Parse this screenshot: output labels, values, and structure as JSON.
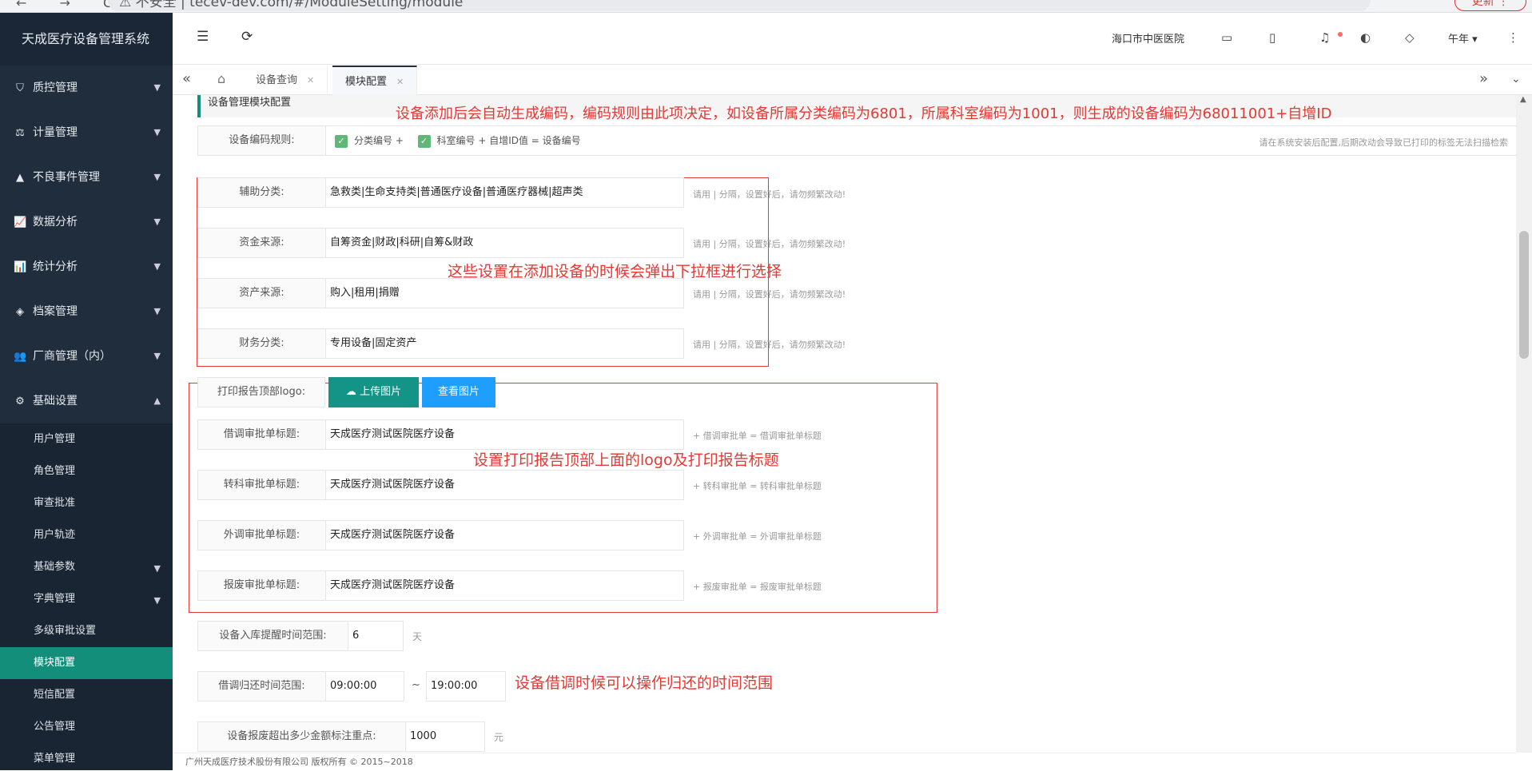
{
  "browser": {
    "nav": "← → C",
    "url": "⚠ 不安全 | tecev-dev.com/#/ModuleSetting/module",
    "update": "更新 ⋮"
  },
  "brand": "天成医疗设备管理系统",
  "menu": [
    {
      "label": "质控管理",
      "icon": "⛉"
    },
    {
      "label": "计量管理",
      "icon": "⚖"
    },
    {
      "label": "不良事件管理",
      "icon": "▲"
    },
    {
      "label": "数据分析",
      "icon": "📈"
    },
    {
      "label": "统计分析",
      "icon": "📊"
    },
    {
      "label": "档案管理",
      "icon": "◈"
    },
    {
      "label": "厂商管理（内）",
      "icon": "👥"
    },
    {
      "label": "基础设置",
      "icon": "⚙"
    }
  ],
  "submenu": [
    "用户管理",
    "角色管理",
    "审查批准",
    "用户轨迹",
    "基础参数",
    "字典管理",
    "多级审批设置",
    "模块配置",
    "短信配置",
    "公告管理",
    "菜单管理"
  ],
  "topbar": {
    "hospital": "海口市中医医院",
    "user": "午年"
  },
  "tabs": [
    "设备查询",
    "模块配置"
  ],
  "section_title": "设备管理模块配置",
  "code_rule": {
    "label": "设备编码规则:",
    "part1": "分类编号 +",
    "part2": "科室编号 + 自增ID值 = 设备编号",
    "hint": "请在系统安装后配置,后期改动会导致已打印的标签无法扫描检索"
  },
  "dropdown_fields": [
    {
      "label": "辅助分类:",
      "value": "急救类|生命支持类|普通医疗设备|普通医疗器械|超声类",
      "hint": "请用 | 分隔，设置好后，请勿频繁改动!"
    },
    {
      "label": "资金来源:",
      "value": "自筹资金|财政|科研|自筹&财政",
      "hint": "请用 | 分隔，设置好后，请勿频繁改动!"
    },
    {
      "label": "资产来源:",
      "value": "购入|租用|捐赠",
      "hint": "请用 | 分隔，设置好后，请勿频繁改动!"
    },
    {
      "label": "财务分类:",
      "value": "专用设备|固定资产",
      "hint": "请用 | 分隔，设置好后，请勿频繁改动!"
    }
  ],
  "logo": {
    "label": "打印报告顶部logo:",
    "upload": "上传图片",
    "view": "查看图片"
  },
  "title_fields": [
    {
      "label": "借调审批单标题:",
      "value": "天成医疗测试医院医疗设备",
      "hint": "+ 借调审批单 = 借调审批单标题"
    },
    {
      "label": "转科审批单标题:",
      "value": "天成医疗测试医院医疗设备",
      "hint": "+ 转科审批单 = 转科审批单标题"
    },
    {
      "label": "外调审批单标题:",
      "value": "天成医疗测试医院医疗设备",
      "hint": "+ 外调审批单 = 外调审批单标题"
    },
    {
      "label": "报废审批单标题:",
      "value": "天成医疗测试医院医疗设备",
      "hint": "+ 报废审批单 = 报废审批单标题"
    }
  ],
  "remind": {
    "label": "设备入库提醒时间范围:",
    "value": "6",
    "unit": "天"
  },
  "borrow": {
    "label": "借调归还时间范围:",
    "start": "09:00:00",
    "sep": "~",
    "end": "19:00:00"
  },
  "scrap": {
    "label": "设备报废超出多少金额标注重点:",
    "value": "1000",
    "unit": "元"
  },
  "annotations": {
    "a1": "设备添加后会自动生成编码，编码规则由此项决定，如设备所属分类编码为6801，所属科室编码为1001，则生成的设备编码为68011001+自增ID",
    "a2": "这些设置在添加设备的时候会弹出下拉框进行选择",
    "a3": "设置打印报告顶部上面的logo及打印报告标题",
    "a4": "设备借调时候可以操作归还的时间范围"
  },
  "footer": "广州天成医疗技术股份有限公司 版权所有 © 2015~2018",
  "colors": {
    "sidebar": "#1f2d3d",
    "active": "#138e7b",
    "upload_btn": "#139486",
    "view_btn": "#1e9fff",
    "annotation": "#e53935"
  }
}
